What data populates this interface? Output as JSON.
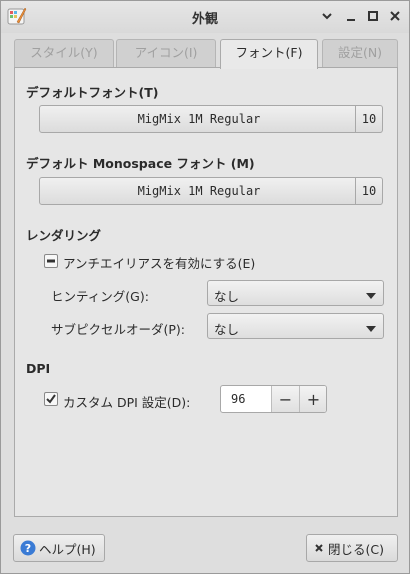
{
  "window": {
    "title": "外観"
  },
  "titlebar": {
    "icons": [
      "app-icon",
      "chevron-down-icon",
      "minimize-icon",
      "maximize-icon",
      "close-icon"
    ]
  },
  "tabs": [
    {
      "label": "スタイル(Y)",
      "active": false
    },
    {
      "label": "アイコン(I)",
      "active": false
    },
    {
      "label": "フォント(F)",
      "active": true
    },
    {
      "label": "設定(N)",
      "active": false
    }
  ],
  "default_font": {
    "heading": "デフォルトフォント(T)",
    "name": "MigMix 1M Regular",
    "size": "10"
  },
  "monospace_font": {
    "heading": "デフォルト Monospace フォント (M)",
    "name": "MigMix 1M Regular",
    "size": "10"
  },
  "rendering": {
    "heading": "レンダリング",
    "antialias_label": "アンチエイリアスを有効にする(E)",
    "antialias_state": "inconsistent",
    "hinting_label": "ヒンティング(G):",
    "hinting_value": "なし",
    "subpixel_label": "サブピクセルオーダ(P):",
    "subpixel_value": "なし"
  },
  "dpi": {
    "heading": "DPI",
    "custom_label": "カスタム DPI 設定(D):",
    "custom_checked": true,
    "value": "96",
    "minus": "−",
    "plus": "+"
  },
  "footer": {
    "help_label": "ヘルプ(H)",
    "close_label": "閉じる(C)"
  },
  "colors": {
    "help_icon": "#3a7bd5",
    "window_bg": "#dedede",
    "panel_bg": "#e6e6e6"
  }
}
